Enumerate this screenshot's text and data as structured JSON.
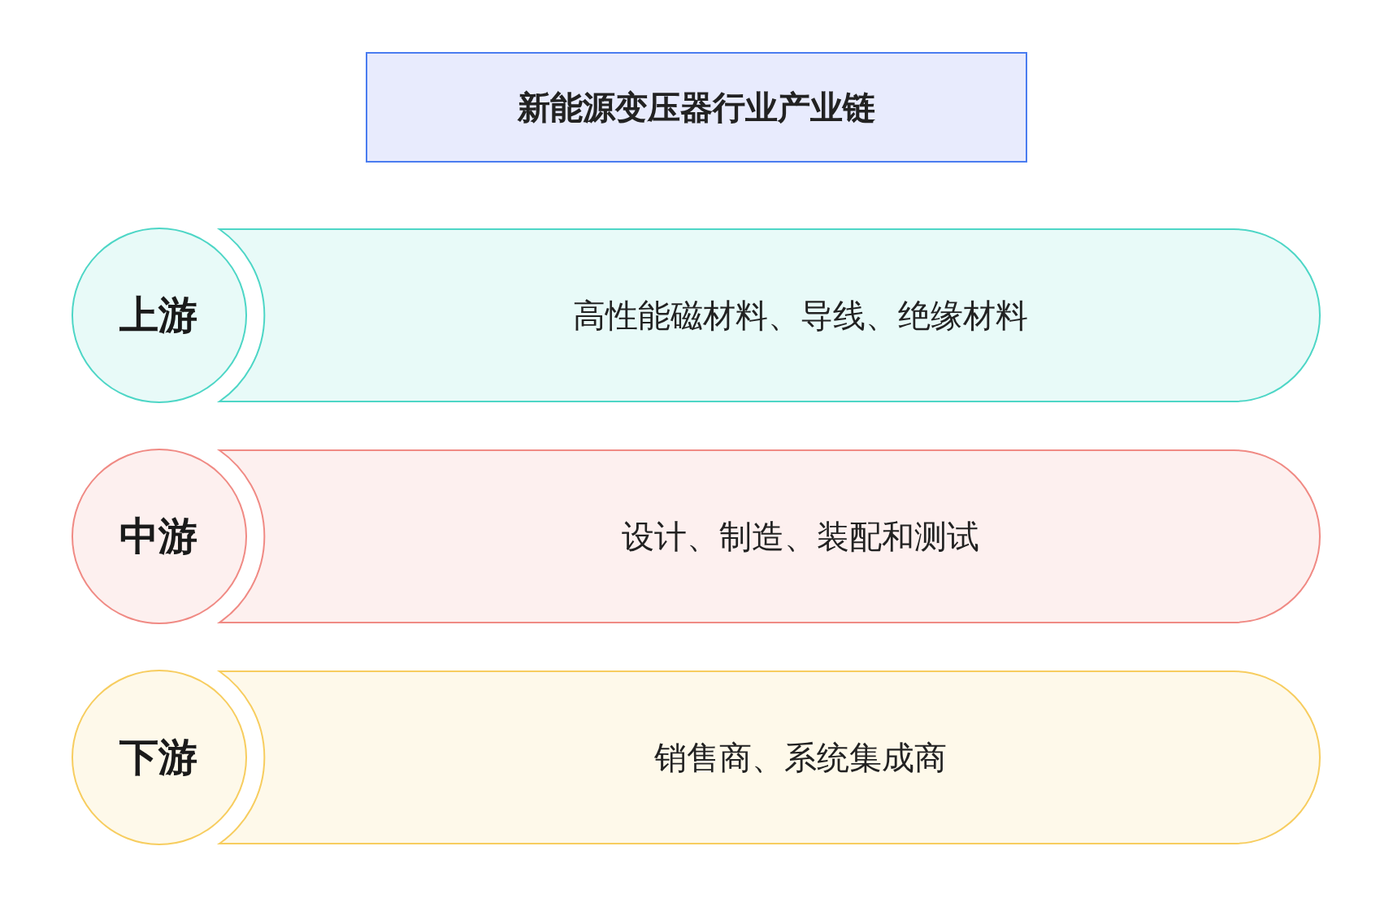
{
  "title": "新能源变压器行业产业链",
  "stages": [
    {
      "label": "上游",
      "content": "高性能磁材料、导线、绝缘材料",
      "color": "#4dd6c6"
    },
    {
      "label": "中游",
      "content": "设计、制造、装配和测试",
      "color": "#f08a84"
    },
    {
      "label": "下游",
      "content": "销售商、系统集成商",
      "color": "#f7cd5f"
    }
  ]
}
